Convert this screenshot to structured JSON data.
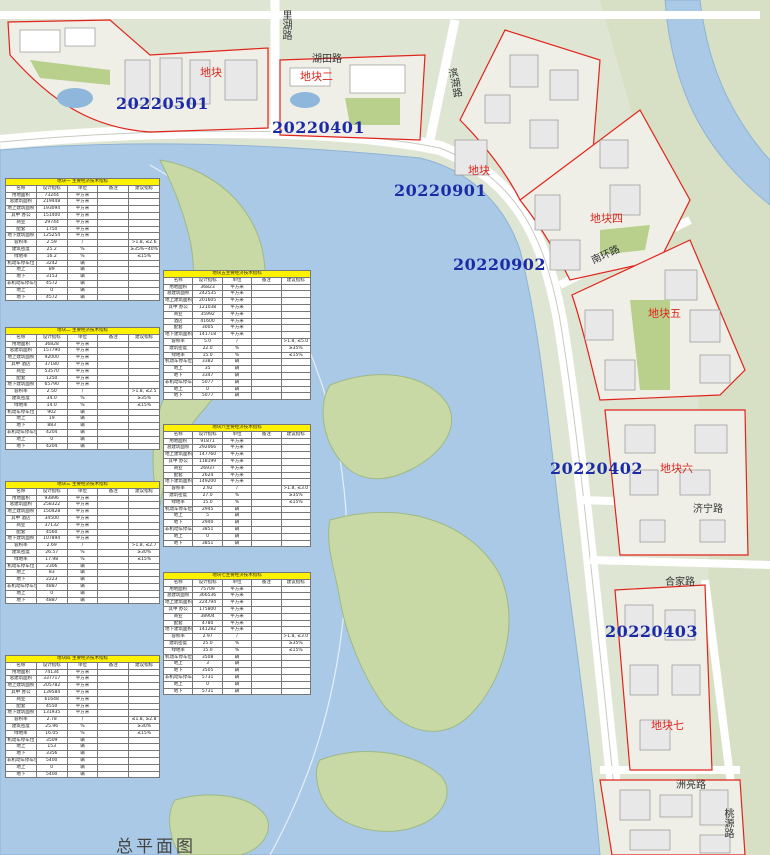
{
  "map_title": "总平面图",
  "parcel_codes": [
    "20220501",
    "20220401",
    "20220901",
    "20220902",
    "20220402",
    "20220403"
  ],
  "plot_labels": [
    "地块",
    "地块二",
    "地块",
    "地块四",
    "地块五",
    "地块六",
    "地块七"
  ],
  "road_labels": {
    "lihu": "里湖路",
    "hutian": "湖田路",
    "right_top": "滨湖路",
    "middle": "南环路",
    "lower_right": "济宁路",
    "bottom": "合家路",
    "lower2": "洲亮路",
    "bottom_right": "桃源路"
  },
  "colors": {
    "water": "#a9c9e6",
    "land": "#dfe5d3",
    "block": "#efefe8",
    "green": "#b8d08b",
    "boundary": "#e0241b",
    "code_text": "#1b2ba6",
    "table_header": "#fff200"
  },
  "tables": [
    {
      "title": "地块一 主要经济技术指标",
      "headers": [
        "名称",
        "设计指标",
        "单位",
        "备注",
        "建议指标"
      ],
      "rows": [
        [
          "用地面积",
          "73244",
          "平方米",
          "",
          ""
        ],
        [
          "总建筑面积",
          "219448",
          "平方米",
          "",
          ""
        ],
        [
          "地上建筑面积",
          "193094",
          "平方米",
          "",
          ""
        ],
        [
          "其中 办公",
          "151400",
          "平方米",
          "",
          ""
        ],
        [
          "商业",
          "29744",
          "平方米",
          "",
          ""
        ],
        [
          "配套",
          "1750",
          "平方米",
          "",
          ""
        ],
        [
          "地下建筑面积",
          "125254",
          "平方米",
          "",
          ""
        ],
        [
          "容积率",
          "2.59",
          "/",
          "",
          ">1.8, ≤2.6"
        ],
        [
          "建筑密度",
          "25.2",
          "%",
          "",
          "≥35%~40%"
        ],
        [
          "绿地率",
          "16.2",
          "%",
          "",
          "≤15%"
        ],
        [
          "机动车停车位",
          "3242",
          "辆",
          "",
          ""
        ],
        [
          "地上",
          "89",
          "辆",
          "",
          ""
        ],
        [
          "地下",
          "3153",
          "辆",
          "",
          ""
        ],
        [
          "非机动车停车位",
          "4572",
          "辆",
          "",
          ""
        ],
        [
          "地上",
          "0",
          "辆",
          "",
          ""
        ],
        [
          "地下",
          "4572",
          "辆",
          "",
          ""
        ]
      ]
    },
    {
      "title": "地块二 主要经济技术指标",
      "headers": [
        "名称",
        "设计指标",
        "单位",
        "备注",
        "建议指标"
      ],
      "rows": [
        [
          "用地面积",
          "36828",
          "平方米",
          "",
          ""
        ],
        [
          "总建筑面积",
          "157790",
          "平方米",
          "",
          ""
        ],
        [
          "地上建筑面积",
          "92000",
          "平方米",
          "",
          ""
        ],
        [
          "其中 酒店",
          "37180",
          "平方米",
          "",
          ""
        ],
        [
          "商业",
          "53570",
          "平方米",
          "",
          ""
        ],
        [
          "配套",
          "1250",
          "平方米",
          "",
          ""
        ],
        [
          "地下建筑面积",
          "65790",
          "平方米",
          "",
          ""
        ],
        [
          "容积率",
          "2.50",
          "/",
          "",
          ">1.8, ≤2.5"
        ],
        [
          "建筑密度",
          "34.0",
          "%",
          "",
          "≥35%"
        ],
        [
          "绿地率",
          "14.0",
          "%",
          "",
          "≤15%"
        ],
        [
          "机动车停车位",
          "902",
          "辆",
          "",
          ""
        ],
        [
          "地上",
          "19",
          "辆",
          "",
          ""
        ],
        [
          "地下",
          "883",
          "辆",
          "",
          ""
        ],
        [
          "非机动车停车位",
          "4204",
          "辆",
          "",
          ""
        ],
        [
          "地上",
          "0",
          "辆",
          "",
          ""
        ],
        [
          "地下",
          "4204",
          "辆",
          "",
          ""
        ]
      ]
    },
    {
      "title": "地块三 主要经济技术指标",
      "headers": [
        "名称",
        "设计指标",
        "单位",
        "备注",
        "建议指标"
      ],
      "rows": [
        [
          "用地面积",
          "93896",
          "平方米",
          "",
          ""
        ],
        [
          "总建筑面积",
          "258322",
          "平方米",
          "",
          ""
        ],
        [
          "地上建筑面积",
          "150428",
          "平方米",
          "",
          ""
        ],
        [
          "其中 酒店",
          "34500",
          "平方米",
          "",
          ""
        ],
        [
          "商业",
          "37132",
          "平方米",
          "",
          ""
        ],
        [
          "配套",
          "4560",
          "平方米",
          "",
          ""
        ],
        [
          "地下建筑面积",
          "107894",
          "平方米",
          "",
          ""
        ],
        [
          "容积率",
          "2.69",
          "/",
          "",
          ">1.8, ≤2.7"
        ],
        [
          "建筑密度",
          "26.57",
          "%",
          "",
          "≥30%"
        ],
        [
          "绿地率",
          "17.98",
          "%",
          "",
          "≤15%"
        ],
        [
          "机动车停车位",
          "2306",
          "辆",
          "",
          ""
        ],
        [
          "地上",
          "83",
          "辆",
          "",
          ""
        ],
        [
          "地下",
          "2223",
          "辆",
          "",
          ""
        ],
        [
          "非机动车停车位",
          "4887",
          "辆",
          "",
          ""
        ],
        [
          "地上",
          "0",
          "辆",
          "",
          ""
        ],
        [
          "地下",
          "4887",
          "辆",
          "",
          ""
        ]
      ]
    },
    {
      "title": "地块四 主要经济技术指标",
      "headers": [
        "名称",
        "设计指标",
        "单位",
        "备注",
        "建议指标"
      ],
      "rows": [
        [
          "用地面积",
          "74134",
          "平方米",
          "",
          ""
        ],
        [
          "总建筑面积",
          "337717",
          "平方米",
          "",
          ""
        ],
        [
          "地上建筑面积",
          "205782",
          "平方米",
          "",
          ""
        ],
        [
          "其中 办公",
          "139584",
          "平方米",
          "",
          ""
        ],
        [
          "商业",
          "61648",
          "平方米",
          "",
          ""
        ],
        [
          "配套",
          "4550",
          "平方米",
          "",
          ""
        ],
        [
          "地下建筑面积",
          "131935",
          "平方米",
          "",
          ""
        ],
        [
          "容积率",
          "2.78",
          "/",
          "",
          "≤1.8, ≥2.8"
        ],
        [
          "建筑密度",
          "25.96",
          "%",
          "",
          "≥30%"
        ],
        [
          "绿地率",
          "16.05",
          "%",
          "",
          "≤15%"
        ],
        [
          "机动车停车位",
          "3509",
          "辆",
          "",
          ""
        ],
        [
          "地上",
          "153",
          "辆",
          "",
          ""
        ],
        [
          "地下",
          "3356",
          "辆",
          "",
          ""
        ],
        [
          "非机动车停车位",
          "5400",
          "辆",
          "",
          ""
        ],
        [
          "地上",
          "0",
          "辆",
          "",
          ""
        ],
        [
          "地下",
          "5400",
          "辆",
          "",
          ""
        ]
      ]
    },
    {
      "title": "地块五主要经济技术指标",
      "headers": [
        "名称",
        "设计指标",
        "单位",
        "备注",
        "建议指标"
      ],
      "rows": [
        [
          "用地面积",
          "36823",
          "平方米",
          "",
          ""
        ],
        [
          "总建筑面积",
          "242535",
          "平方米",
          "",
          ""
        ],
        [
          "地上建筑面积",
          "201605",
          "平方米",
          "",
          ""
        ],
        [
          "其中 办公",
          "121038",
          "平方米",
          "",
          ""
        ],
        [
          "商业",
          "35992",
          "平方米",
          "",
          ""
        ],
        [
          "酒店",
          "41600",
          "平方米",
          "",
          ""
        ],
        [
          "配套",
          "3005",
          "平方米",
          "",
          ""
        ],
        [
          "地下建筑面积",
          "141718",
          "平方米",
          "",
          ""
        ],
        [
          "容积率",
          "5.0",
          "/",
          "",
          ">1.8, ≤5.0"
        ],
        [
          "建筑密度",
          "22.0",
          "%",
          "",
          "≥35%"
        ],
        [
          "绿地率",
          "15.0",
          "%",
          "",
          "≤15%"
        ],
        [
          "机动车停车位",
          "3382",
          "辆",
          "",
          ""
        ],
        [
          "地上",
          "35",
          "辆",
          "",
          ""
        ],
        [
          "地下",
          "3347",
          "辆",
          "",
          ""
        ],
        [
          "非机动车停车位",
          "5077",
          "辆",
          "",
          ""
        ],
        [
          "地上",
          "0",
          "辆",
          "",
          ""
        ],
        [
          "地下",
          "5077",
          "辆",
          "",
          ""
        ]
      ]
    },
    {
      "title": "地块六主要经济技术指标",
      "headers": [
        "名称",
        "设计指标",
        "单位",
        "备注",
        "建议指标"
      ],
      "rows": [
        [
          "用地面积",
          "91871",
          "平方米",
          "",
          ""
        ],
        [
          "总建筑面积",
          "292066",
          "平方米",
          "",
          ""
        ],
        [
          "地上建筑面积",
          "147760",
          "平方米",
          "",
          ""
        ],
        [
          "其中 办公",
          "118199",
          "平方米",
          "",
          ""
        ],
        [
          "商业",
          "26937",
          "平方米",
          "",
          ""
        ],
        [
          "配套",
          "2624",
          "平方米",
          "",
          ""
        ],
        [
          "地下建筑面积",
          "149200",
          "平方米",
          "",
          ""
        ],
        [
          "容积率",
          "2.92",
          "/",
          "",
          ">1.8, ≤3.0"
        ],
        [
          "建筑密度",
          "27.0",
          "%",
          "",
          "≥35%"
        ],
        [
          "绿地率",
          "15.0",
          "%",
          "",
          "≤15%"
        ],
        [
          "机动车停车位",
          "2945",
          "辆",
          "",
          ""
        ],
        [
          "地上",
          "5",
          "辆",
          "",
          ""
        ],
        [
          "地下",
          "2940",
          "辆",
          "",
          ""
        ],
        [
          "非机动车停车位",
          "3851",
          "辆",
          "",
          ""
        ],
        [
          "地上",
          "0",
          "辆",
          "",
          ""
        ],
        [
          "地下",
          "3851",
          "辆",
          "",
          ""
        ]
      ]
    },
    {
      "title": "地块七主要经济技术指标",
      "headers": [
        "名称",
        "设计指标",
        "单位",
        "备注",
        "建议指标"
      ],
      "rows": [
        [
          "用地面积",
          "75709",
          "平方米",
          "",
          ""
        ],
        [
          "总建筑面积",
          "366536",
          "平方米",
          "",
          ""
        ],
        [
          "地上建筑面积",
          "224794",
          "平方米",
          "",
          ""
        ],
        [
          "其中 办公",
          "175800",
          "平方米",
          "",
          ""
        ],
        [
          "商业",
          "38904",
          "平方米",
          "",
          ""
        ],
        [
          "配套",
          "4780",
          "平方米",
          "",
          ""
        ],
        [
          "地下建筑面积",
          "141282",
          "平方米",
          "",
          ""
        ],
        [
          "容积率",
          "2.97",
          "/",
          "",
          ">1.8, ≤3.0"
        ],
        [
          "建筑密度",
          "25.0",
          "%",
          "",
          "≥35%"
        ],
        [
          "绿地率",
          "15.0",
          "%",
          "",
          "≤15%"
        ],
        [
          "机动车停车位",
          "3508",
          "辆",
          "",
          ""
        ],
        [
          "地上",
          "3",
          "辆",
          "",
          ""
        ],
        [
          "地下",
          "3505",
          "辆",
          "",
          ""
        ],
        [
          "非机动车停车位",
          "5731",
          "辆",
          "",
          ""
        ],
        [
          "地上",
          "0",
          "辆",
          "",
          ""
        ],
        [
          "地下",
          "5731",
          "辆",
          "",
          ""
        ]
      ]
    }
  ]
}
